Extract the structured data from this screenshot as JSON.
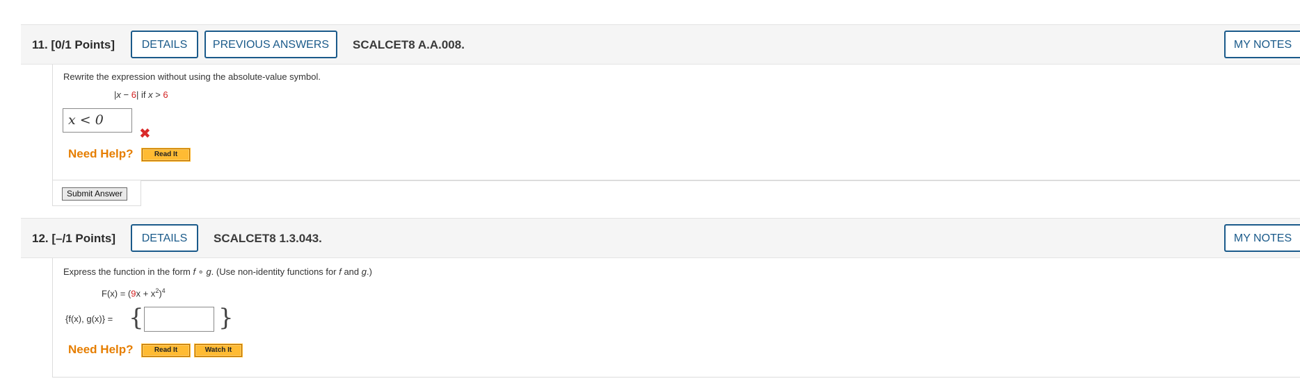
{
  "q11": {
    "title": "11. [0/1 Points]",
    "details": "DETAILS",
    "previous_answers": "PREVIOUS ANSWERS",
    "ref": "SCALCET8 A.A.008.",
    "my_notes": "MY NOTES",
    "prompt": "Rewrite the expression without using the absolute-value symbol.",
    "expr_left": "|",
    "expr_x": "x",
    "expr_minus": " − ",
    "expr_6": "6",
    "expr_right": "|",
    "expr_if": " if ",
    "expr_x2": "x",
    "expr_gt": " > ",
    "expr_6b": "6",
    "answer_value": "x < 0",
    "answer_correct": false,
    "need_help": "Need Help?",
    "read_it": "Read It",
    "submit": "Submit Answer"
  },
  "q12": {
    "title": "12. [–/1 Points]",
    "details": "DETAILS",
    "ref": "SCALCET8 1.3.043.",
    "my_notes": "MY NOTES",
    "prompt_a": "Express the function in the form  ",
    "prompt_f": "f",
    "prompt_o": " ∘ ",
    "prompt_g": "g",
    "prompt_b": ".  (Use non-identity functions for ",
    "prompt_f2": "f",
    "prompt_and": " and ",
    "prompt_g2": "g",
    "prompt_c": ".)",
    "func_lhs": "F(x) = (",
    "func_9": "9",
    "func_rest": "x + x",
    "func_sq": "2",
    "func_close": ")",
    "func_pow": "4",
    "pair_label": "{f(x), g(x)} = ",
    "brace_open": "{",
    "brace_close": "}",
    "answer_value": "",
    "need_help": "Need Help?",
    "read_it": "Read It",
    "watch_it": "Watch It"
  },
  "colors": {
    "accent": "#1a5a8a",
    "help": "#e67e00",
    "button_yellow": "#ffbb33",
    "red": "#d11f1f"
  }
}
